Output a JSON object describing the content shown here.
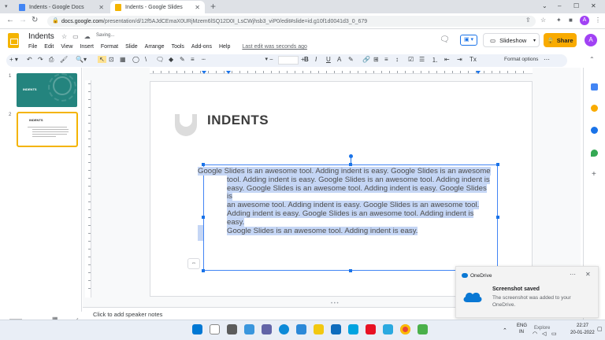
{
  "browser": {
    "tabs": [
      {
        "title": "Indents - Google Docs",
        "active": false,
        "favicon_color": "#4285f4"
      },
      {
        "title": "Indents - Google Slides",
        "active": true,
        "favicon_color": "#f4b400"
      }
    ],
    "new_tab": "+",
    "window_controls": [
      "⌄",
      "–",
      "☐",
      "✕"
    ],
    "url_domain": "docs.google.com",
    "url_path": "/presentation/d/12f5AJdCEmaX0URjMzem6lSQ12D0I_LsCWjhsb3_viP0/edit#slide=id.g10f1d0041d3_0_679",
    "profile_initial": "A"
  },
  "app": {
    "doc_title": "Indents",
    "saving": "Saving...",
    "menus": [
      "File",
      "Edit",
      "View",
      "Insert",
      "Format",
      "Slide",
      "Arrange",
      "Tools",
      "Add-ons",
      "Help"
    ],
    "last_edit": "Last edit was seconds ago",
    "slideshow_label": "Slideshow",
    "share_label": "Share",
    "account_initial": "A",
    "format_options": "Format options",
    "more": "⋯"
  },
  "filmstrip": {
    "slides": [
      {
        "number": "1",
        "title": "INDENTS"
      },
      {
        "number": "2",
        "title": "INDENTS",
        "selected": true
      }
    ]
  },
  "slide": {
    "title": "INDENTS",
    "body_first_line": "Google Slides is an awesome tool. Adding indent is easy. Google Slides is an awesome",
    "body_rest_lines": [
      "tool. Adding indent is easy. Google Slides is an awesome tool. Adding indent is",
      "easy. Google Slides is an awesome tool. Adding indent is easy. Google Slides is",
      "an awesome tool. Adding indent is easy. Google Slides is an awesome tool.",
      "Adding indent is easy. Google Slides is an awesome tool. Adding indent is easy.",
      "Google Slides is an awesome tool. Adding indent is easy."
    ]
  },
  "notes_placeholder": "Click to add speaker notes",
  "toast": {
    "app_name": "OneDrive",
    "heading": "Screenshot saved",
    "body": "The screenshot was added to your OneDrive."
  },
  "taskbar": {
    "language": "ENG",
    "region": "IN",
    "time": "22:27",
    "date": "20-01-2022",
    "explore": "Explore"
  }
}
